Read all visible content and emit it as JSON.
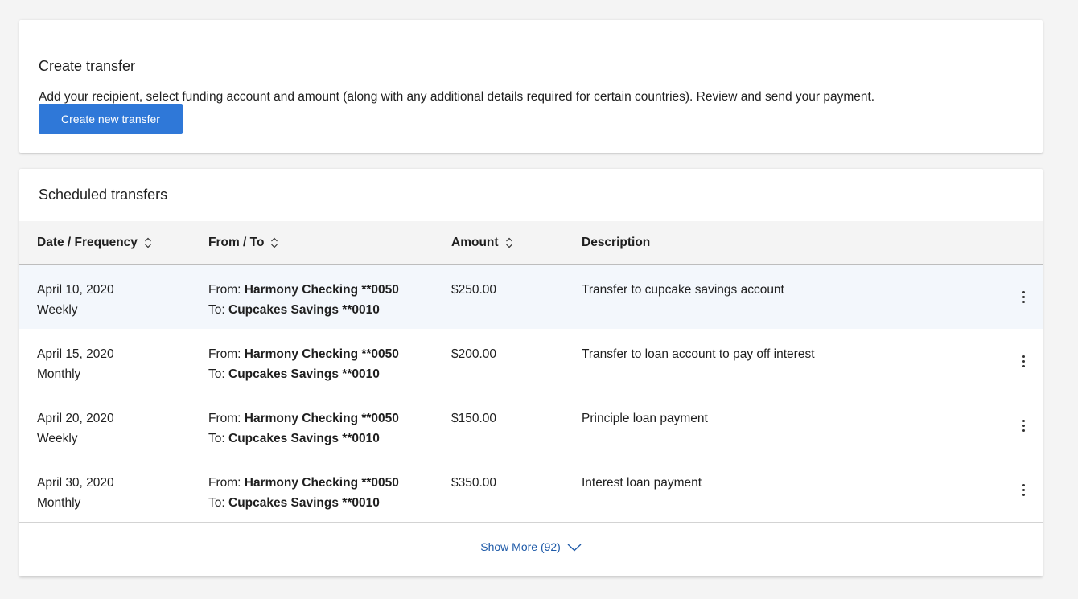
{
  "create": {
    "title": "Create transfer",
    "description": "Add your recipient, select funding account and amount (along with any additional details required for certain countries). Review and send your payment.",
    "button_label": "Create new transfer",
    "accent": "#2f78d8"
  },
  "scheduled": {
    "title": "Scheduled transfers",
    "columns": {
      "date": "Date / Frequency",
      "fromto": "From / To",
      "amount": "Amount",
      "description": "Description"
    },
    "from_prefix": "From:",
    "to_prefix": "To:",
    "rows": [
      {
        "date": "April 10, 2020",
        "frequency": "Weekly",
        "from": "Harmony Checking **0050",
        "to": "Cupcakes Savings **0010",
        "amount": "$250.00",
        "description": "Transfer to cupcake savings account"
      },
      {
        "date": "April 15, 2020",
        "frequency": "Monthly",
        "from": "Harmony Checking **0050",
        "to": "Cupcakes Savings **0010",
        "amount": "$200.00",
        "description": "Transfer to loan account to pay off interest"
      },
      {
        "date": "April 20, 2020",
        "frequency": "Weekly",
        "from": "Harmony Checking **0050",
        "to": "Cupcakes Savings **0010",
        "amount": "$150.00",
        "description": "Principle loan payment"
      },
      {
        "date": "April 30, 2020",
        "frequency": "Monthly",
        "from": "Harmony Checking **0050",
        "to": "Cupcakes Savings **0010",
        "amount": "$350.00",
        "description": "Interest loan payment"
      }
    ],
    "show_more_label": "Show More (92)",
    "icons": {
      "sort": "sort-icon",
      "row_menu": "kebab-menu-icon",
      "show_more": "chevron-down-icon"
    }
  }
}
